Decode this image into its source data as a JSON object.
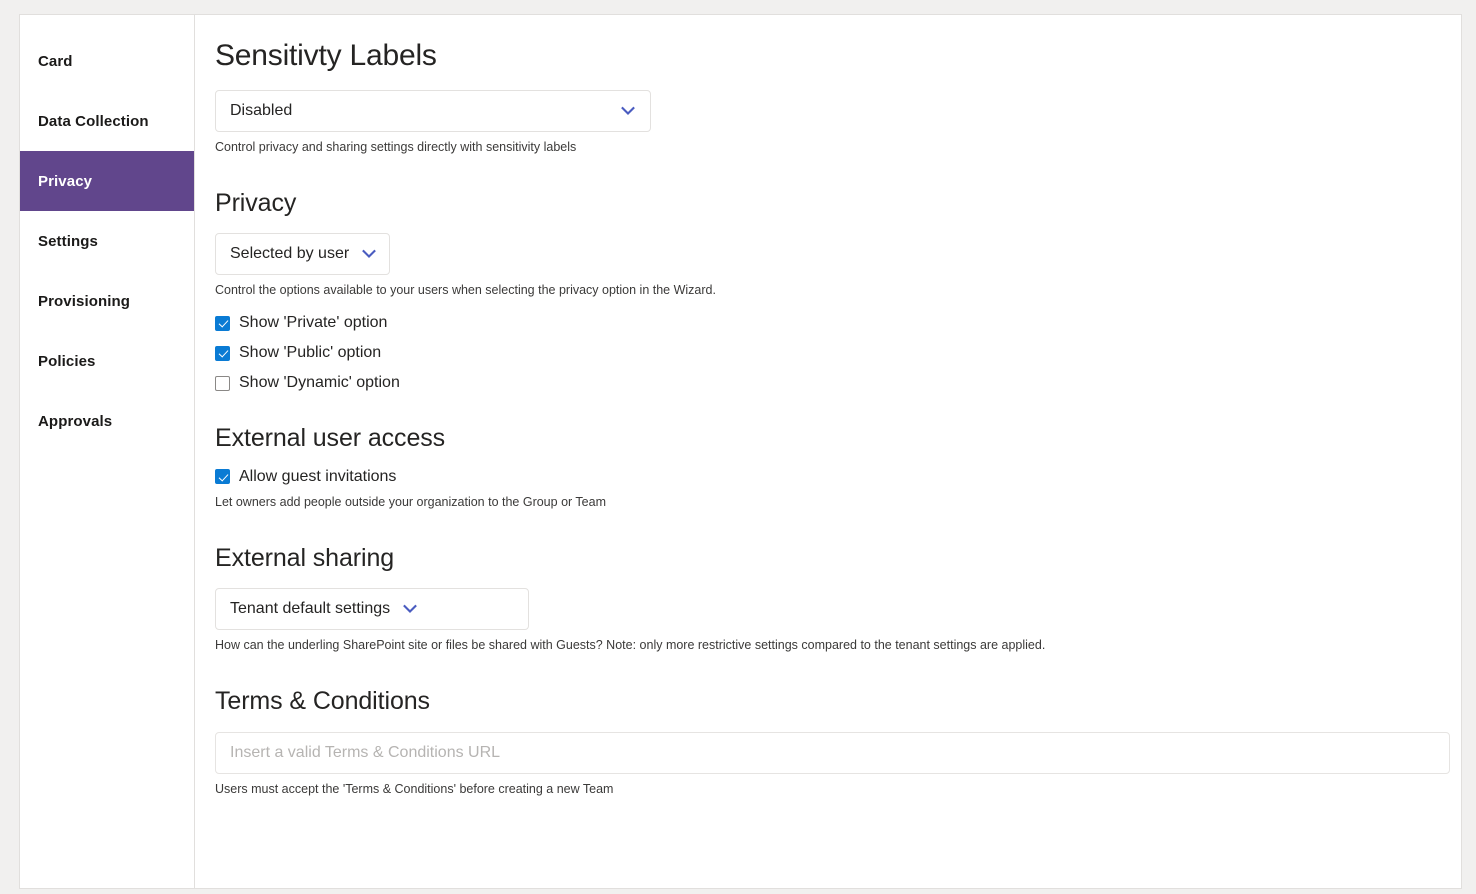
{
  "theme": {
    "page_background": "#f1f0ef",
    "card_background": "#ffffff",
    "selected_nav_background": "#61468c",
    "selected_nav_text": "#ffffff",
    "chevron_color": "#4a5cc0",
    "checkbox_checked_color": "#0a7bd4",
    "heading_color": "#252423",
    "helper_text_color": "#3b3a39",
    "border_color": "#e1dfdd"
  },
  "sidebar": {
    "items": [
      {
        "label": "Card",
        "selected": false
      },
      {
        "label": "Data Collection",
        "selected": false
      },
      {
        "label": "Privacy",
        "selected": true
      },
      {
        "label": "Settings",
        "selected": false
      },
      {
        "label": "Provisioning",
        "selected": false
      },
      {
        "label": "Policies",
        "selected": false
      },
      {
        "label": "Approvals",
        "selected": false
      }
    ]
  },
  "main": {
    "sensitivity_labels": {
      "title": "Sensitivty Labels",
      "dropdown_value": "Disabled",
      "helper": "Control privacy and sharing settings directly with sensitivity labels",
      "chevron_icon": "chevron-down-icon"
    },
    "privacy": {
      "title": "Privacy",
      "dropdown_value": "Selected by user",
      "helper": "Control the options available to your users when selecting the privacy option in the Wizard.",
      "chevron_icon": "chevron-down-icon",
      "options": [
        {
          "label": "Show 'Private' option",
          "checked": true
        },
        {
          "label": "Show 'Public' option",
          "checked": true
        },
        {
          "label": "Show 'Dynamic' option",
          "checked": false
        }
      ]
    },
    "external_user_access": {
      "title": "External user access",
      "checkbox_label": "Allow guest invitations",
      "checked": true,
      "helper": "Let owners add people outside your organization to the Group or Team"
    },
    "external_sharing": {
      "title": "External sharing",
      "dropdown_value": "Tenant default settings",
      "helper": "How can the underling SharePoint site or files be shared with Guests? Note: only more restrictive settings compared to the tenant settings are applied.",
      "chevron_icon": "chevron-down-icon"
    },
    "terms_and_conditions": {
      "title": "Terms & Conditions",
      "input_value": "",
      "input_placeholder": "Insert a valid Terms & Conditions URL",
      "helper": "Users must accept the 'Terms & Conditions' before creating a new Team"
    }
  }
}
